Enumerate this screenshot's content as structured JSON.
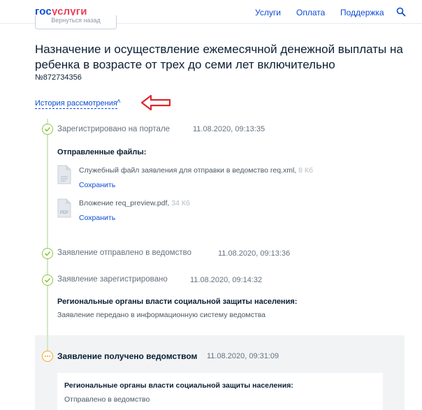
{
  "header": {
    "logo_part1": "гос",
    "logo_part2": "услуги",
    "nav": [
      "Услуги",
      "Оплата",
      "Поддержка"
    ],
    "search_icon": "search-icon"
  },
  "back_button": "Вернуться назад",
  "page": {
    "title": "Назначение и осуществление ежемесячной денежной выплаты на ребенка в возрасте от трех до семи лет включительно",
    "number": "№872734356",
    "history_link": "История рассмотрения",
    "history_chevron": "˄"
  },
  "colors": {
    "accent": "#0d4cd3",
    "done": "#8dc63f",
    "in_progress": "#f5a623",
    "annotation_arrow": "#e0262c"
  },
  "steps": [
    {
      "title": "Зарегистрировано на портале",
      "date": "11.08.2020, 09:13:35",
      "status": "done",
      "files_label": "Отправленные файлы:",
      "files": [
        {
          "name": "Служебный файл заявления для отправки в ведомство req.xml",
          "size": "8 Кб",
          "action": "Сохранить",
          "icon": "document-icon"
        },
        {
          "name": "Вложение req_preview.pdf",
          "size": "34 Кб",
          "action": "Сохранить",
          "icon": "pdf-icon",
          "icon_text": "PDF"
        }
      ]
    },
    {
      "title": "Заявление отправлено в ведомство",
      "date": "11.08.2020, 09:13:36",
      "status": "done"
    },
    {
      "title": "Заявление зарегистрировано",
      "date": "11.08.2020, 09:14:32",
      "status": "done",
      "org": "Региональные органы власти социальной защиты населения:",
      "message": "Заявление передано в информационную систему ведомства"
    },
    {
      "title": "Заявление получено ведомством",
      "date": "11.08.2020, 09:31:09",
      "status": "in_progress",
      "org": "Региональные органы власти социальной защиты населения:",
      "message": "Отправлено в ведомство"
    }
  ]
}
